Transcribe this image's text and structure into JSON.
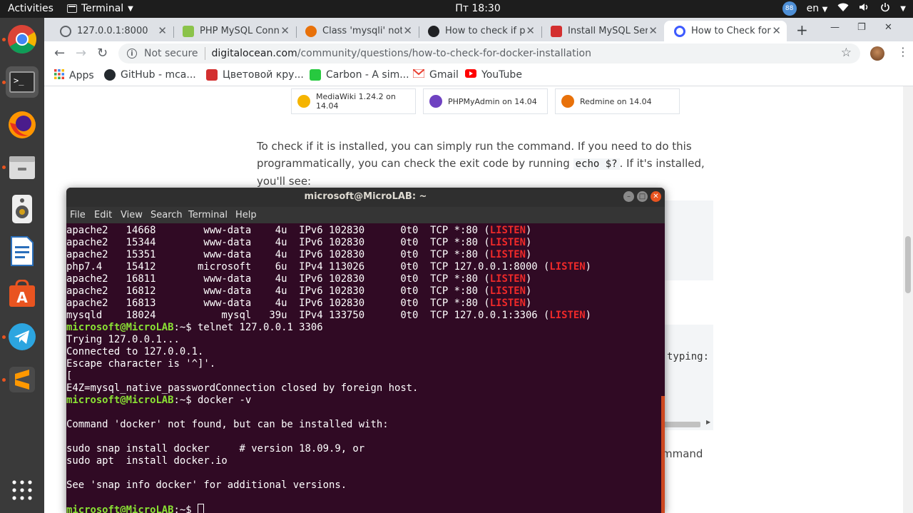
{
  "topbar": {
    "activities": "Activities",
    "app_name": "Terminal",
    "clock": "Пт 18:30",
    "badge": "88",
    "lang": "en"
  },
  "dock": {
    "items": [
      "chrome-icon",
      "terminal-icon",
      "firefox-icon",
      "files-icon",
      "speaker-icon",
      "writer-icon",
      "software-icon",
      "telegram-icon",
      "sublime-icon",
      "apps-grid-icon"
    ]
  },
  "browser": {
    "tabs": [
      {
        "title": "127.0.0.1:8000",
        "color": "#5f6368"
      },
      {
        "title": "PHP MySQL Conn",
        "color": "#8bc34a"
      },
      {
        "title": "Class 'mysqli' not",
        "color": "#e8710a"
      },
      {
        "title": "How to check if p",
        "color": "#202124"
      },
      {
        "title": "Install MySQL Ser",
        "color": "#d32f2f"
      },
      {
        "title": "How to Check for",
        "color": "#3d5afe"
      }
    ],
    "new_tab": "+",
    "omnibox": {
      "security": "Not secure",
      "host": "digitalocean.com",
      "path": "/community/questions/how-to-check-for-docker-installation"
    },
    "bookmarks": [
      {
        "label": "Apps",
        "color": "#4285f4"
      },
      {
        "label": "GitHub - mca...",
        "color": "#24292e"
      },
      {
        "label": "Цветовой кру...",
        "color": "#d32f2f"
      },
      {
        "label": "Carbon - A sim...",
        "color": "#27c93f"
      },
      {
        "label": "Gmail",
        "color": "#ea4335"
      },
      {
        "label": "YouTube",
        "color": "#ff0000"
      }
    ]
  },
  "page": {
    "cards": [
      {
        "label": "MediaWiki 1.24.2 on 14.04",
        "color": "#f5b400"
      },
      {
        "label": "PHPMyAdmin on 14.04",
        "color": "#6f42c1"
      },
      {
        "label": "Redmine on 14.04",
        "color": "#e8710a"
      }
    ],
    "para_start": "To check if it is installed, you can simply run the command. If you need to do this programmatically, you can check the exit code by running ",
    "para_code": "echo $?",
    "para_end": ". If it's installed, you'll see:",
    "frag_typing": "typing:",
    "frag_mmand": "mmand"
  },
  "terminal": {
    "title": "microsoft@MicroLAB: ~",
    "menu": [
      "File",
      "Edit",
      "View",
      "Search",
      "Terminal",
      "Help"
    ],
    "prompt": "microsoft@MicroLAB",
    "rows": [
      {
        "pre": "apache2   14668        www-data    4u  IPv6 102830      0t0  TCP *:80 (",
        "tag": "LISTEN",
        "post": ")"
      },
      {
        "pre": "apache2   15344        www-data    4u  IPv6 102830      0t0  TCP *:80 (",
        "tag": "LISTEN",
        "post": ")"
      },
      {
        "pre": "apache2   15351        www-data    4u  IPv6 102830      0t0  TCP *:80 (",
        "tag": "LISTEN",
        "post": ")"
      },
      {
        "pre": "php7.4    15412       microsoft    6u  IPv4 113026      0t0  TCP 127.0.0.1:8000 (",
        "tag": "LISTEN",
        "post": ")"
      },
      {
        "pre": "apache2   16811        www-data    4u  IPv6 102830      0t0  TCP *:80 (",
        "tag": "LISTEN",
        "post": ")"
      },
      {
        "pre": "apache2   16812        www-data    4u  IPv6 102830      0t0  TCP *:80 (",
        "tag": "LISTEN",
        "post": ")"
      },
      {
        "pre": "apache2   16813        www-data    4u  IPv6 102830      0t0  TCP *:80 (",
        "tag": "LISTEN",
        "post": ")"
      },
      {
        "pre": "mysqld    18024           mysql   39u  IPv4 133750      0t0  TCP 127.0.0.1:3306 (",
        "tag": "LISTEN",
        "post": ")"
      }
    ],
    "cmd1": ":~$ telnet 127.0.0.1 3306",
    "out1": [
      "Trying 127.0.0.1...",
      "Connected to 127.0.0.1.",
      "Escape character is '^]'.",
      "[",
      "E4Z=mysql_native_passwordConnection closed by foreign host."
    ],
    "cmd2": ":~$ docker -v",
    "out2": [
      "",
      "Command 'docker' not found, but can be installed with:",
      "",
      "sudo snap install docker     # version 18.09.9, or",
      "sudo apt  install docker.io",
      "",
      "See 'snap info docker' for additional versions.",
      ""
    ],
    "cmd3": ":~$ "
  }
}
